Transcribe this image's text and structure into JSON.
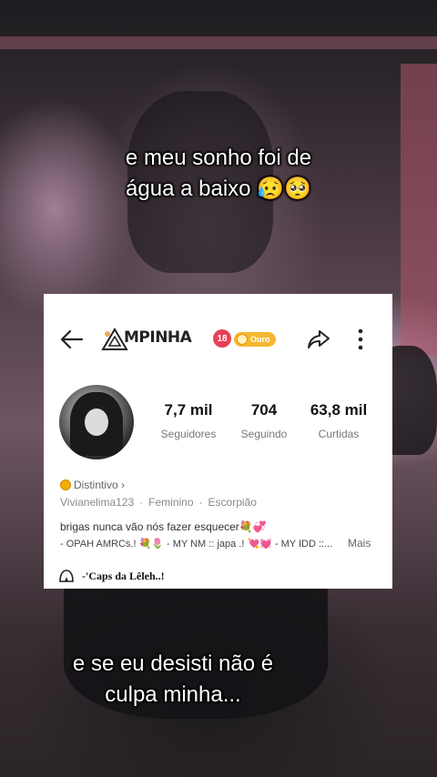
{
  "caption_top": {
    "line1": "e meu sonho foi de",
    "line2": "água a baixo 😥🥺"
  },
  "caption_bottom": {
    "line1": "e se eu desisti não é",
    "line2": "culpa minha..."
  },
  "profile": {
    "username": "MPINHA",
    "age_badge": "18",
    "gold_badge": "Ouro",
    "stats": [
      {
        "value": "7,7 mil",
        "label": "Seguidores"
      },
      {
        "value": "704",
        "label": "Seguindo"
      },
      {
        "value": "63,8 mil",
        "label": "Curtidas"
      }
    ],
    "distintivo": "Distintivo ›",
    "meta": {
      "handle": "Vivianelima123",
      "gender": "Feminino",
      "sign": "Escorpião",
      "separator": "·"
    },
    "bio_line1": "brigas nunca vão nós fazer esquecer💐💞",
    "bio_line2": "- OPAH AMRCs.! 💐🌷 - MY NM :: japa .! 💘💓 - MY IDD ::...",
    "more_label": "Mais",
    "caps_label": "-'Caps da Lêleh..!"
  },
  "colors": {
    "card_bg": "#ffffff",
    "age_badge": "#e8415a",
    "gold_badge": "#f5b730"
  },
  "icons": [
    "back-arrow-icon",
    "logo-triangle-icon",
    "share-icon",
    "more-vertical-icon",
    "caps-tent-icon",
    "distintivo-icon"
  ]
}
